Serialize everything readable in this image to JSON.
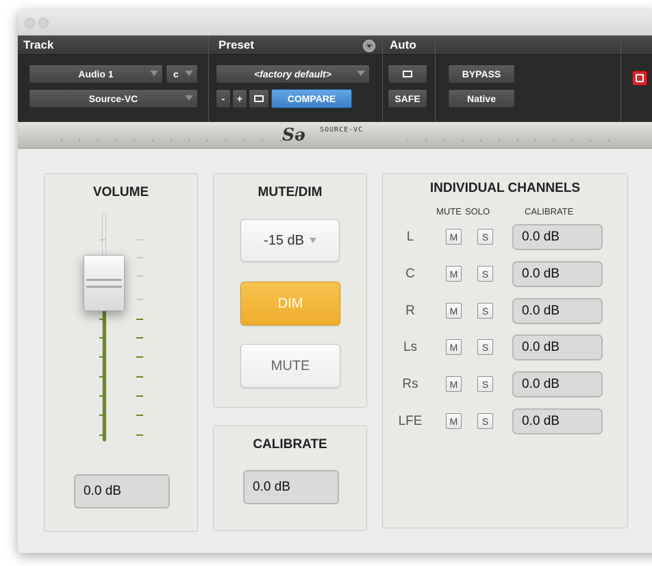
{
  "header": {
    "track_label": "Track",
    "preset_label": "Preset",
    "auto_label": "Auto",
    "track_name": "Audio 1",
    "channel_mode": "c",
    "plugin_name": "Source-VC",
    "preset_name": "<factory default>",
    "minus": "-",
    "plus": "+",
    "compare": "COMPARE",
    "safe": "SAFE",
    "bypass": "BYPASS",
    "native": "Native"
  },
  "brand": {
    "logo": "Sə",
    "name": "SOURCE-VC"
  },
  "volume": {
    "title": "VOLUME",
    "value": "0.0 dB"
  },
  "mutedim": {
    "title": "MUTE/DIM",
    "dim_amount": "-15 dB",
    "dim": "DIM",
    "mute": "MUTE"
  },
  "calibrate": {
    "title": "CALIBRATE",
    "value": "0.0 dB"
  },
  "channels": {
    "title": "INDIVIDUAL CHANNELS",
    "col_mute": "MUTE",
    "col_solo": "SOLO",
    "col_calibrate": "CALIBRATE",
    "m": "M",
    "s": "S",
    "rows": [
      {
        "name": "L",
        "value": "0.0 dB"
      },
      {
        "name": "C",
        "value": "0.0 dB"
      },
      {
        "name": "R",
        "value": "0.0 dB"
      },
      {
        "name": "Ls",
        "value": "0.0 dB"
      },
      {
        "name": "Rs",
        "value": "0.0 dB"
      },
      {
        "name": "LFE",
        "value": "0.0 dB"
      }
    ]
  }
}
